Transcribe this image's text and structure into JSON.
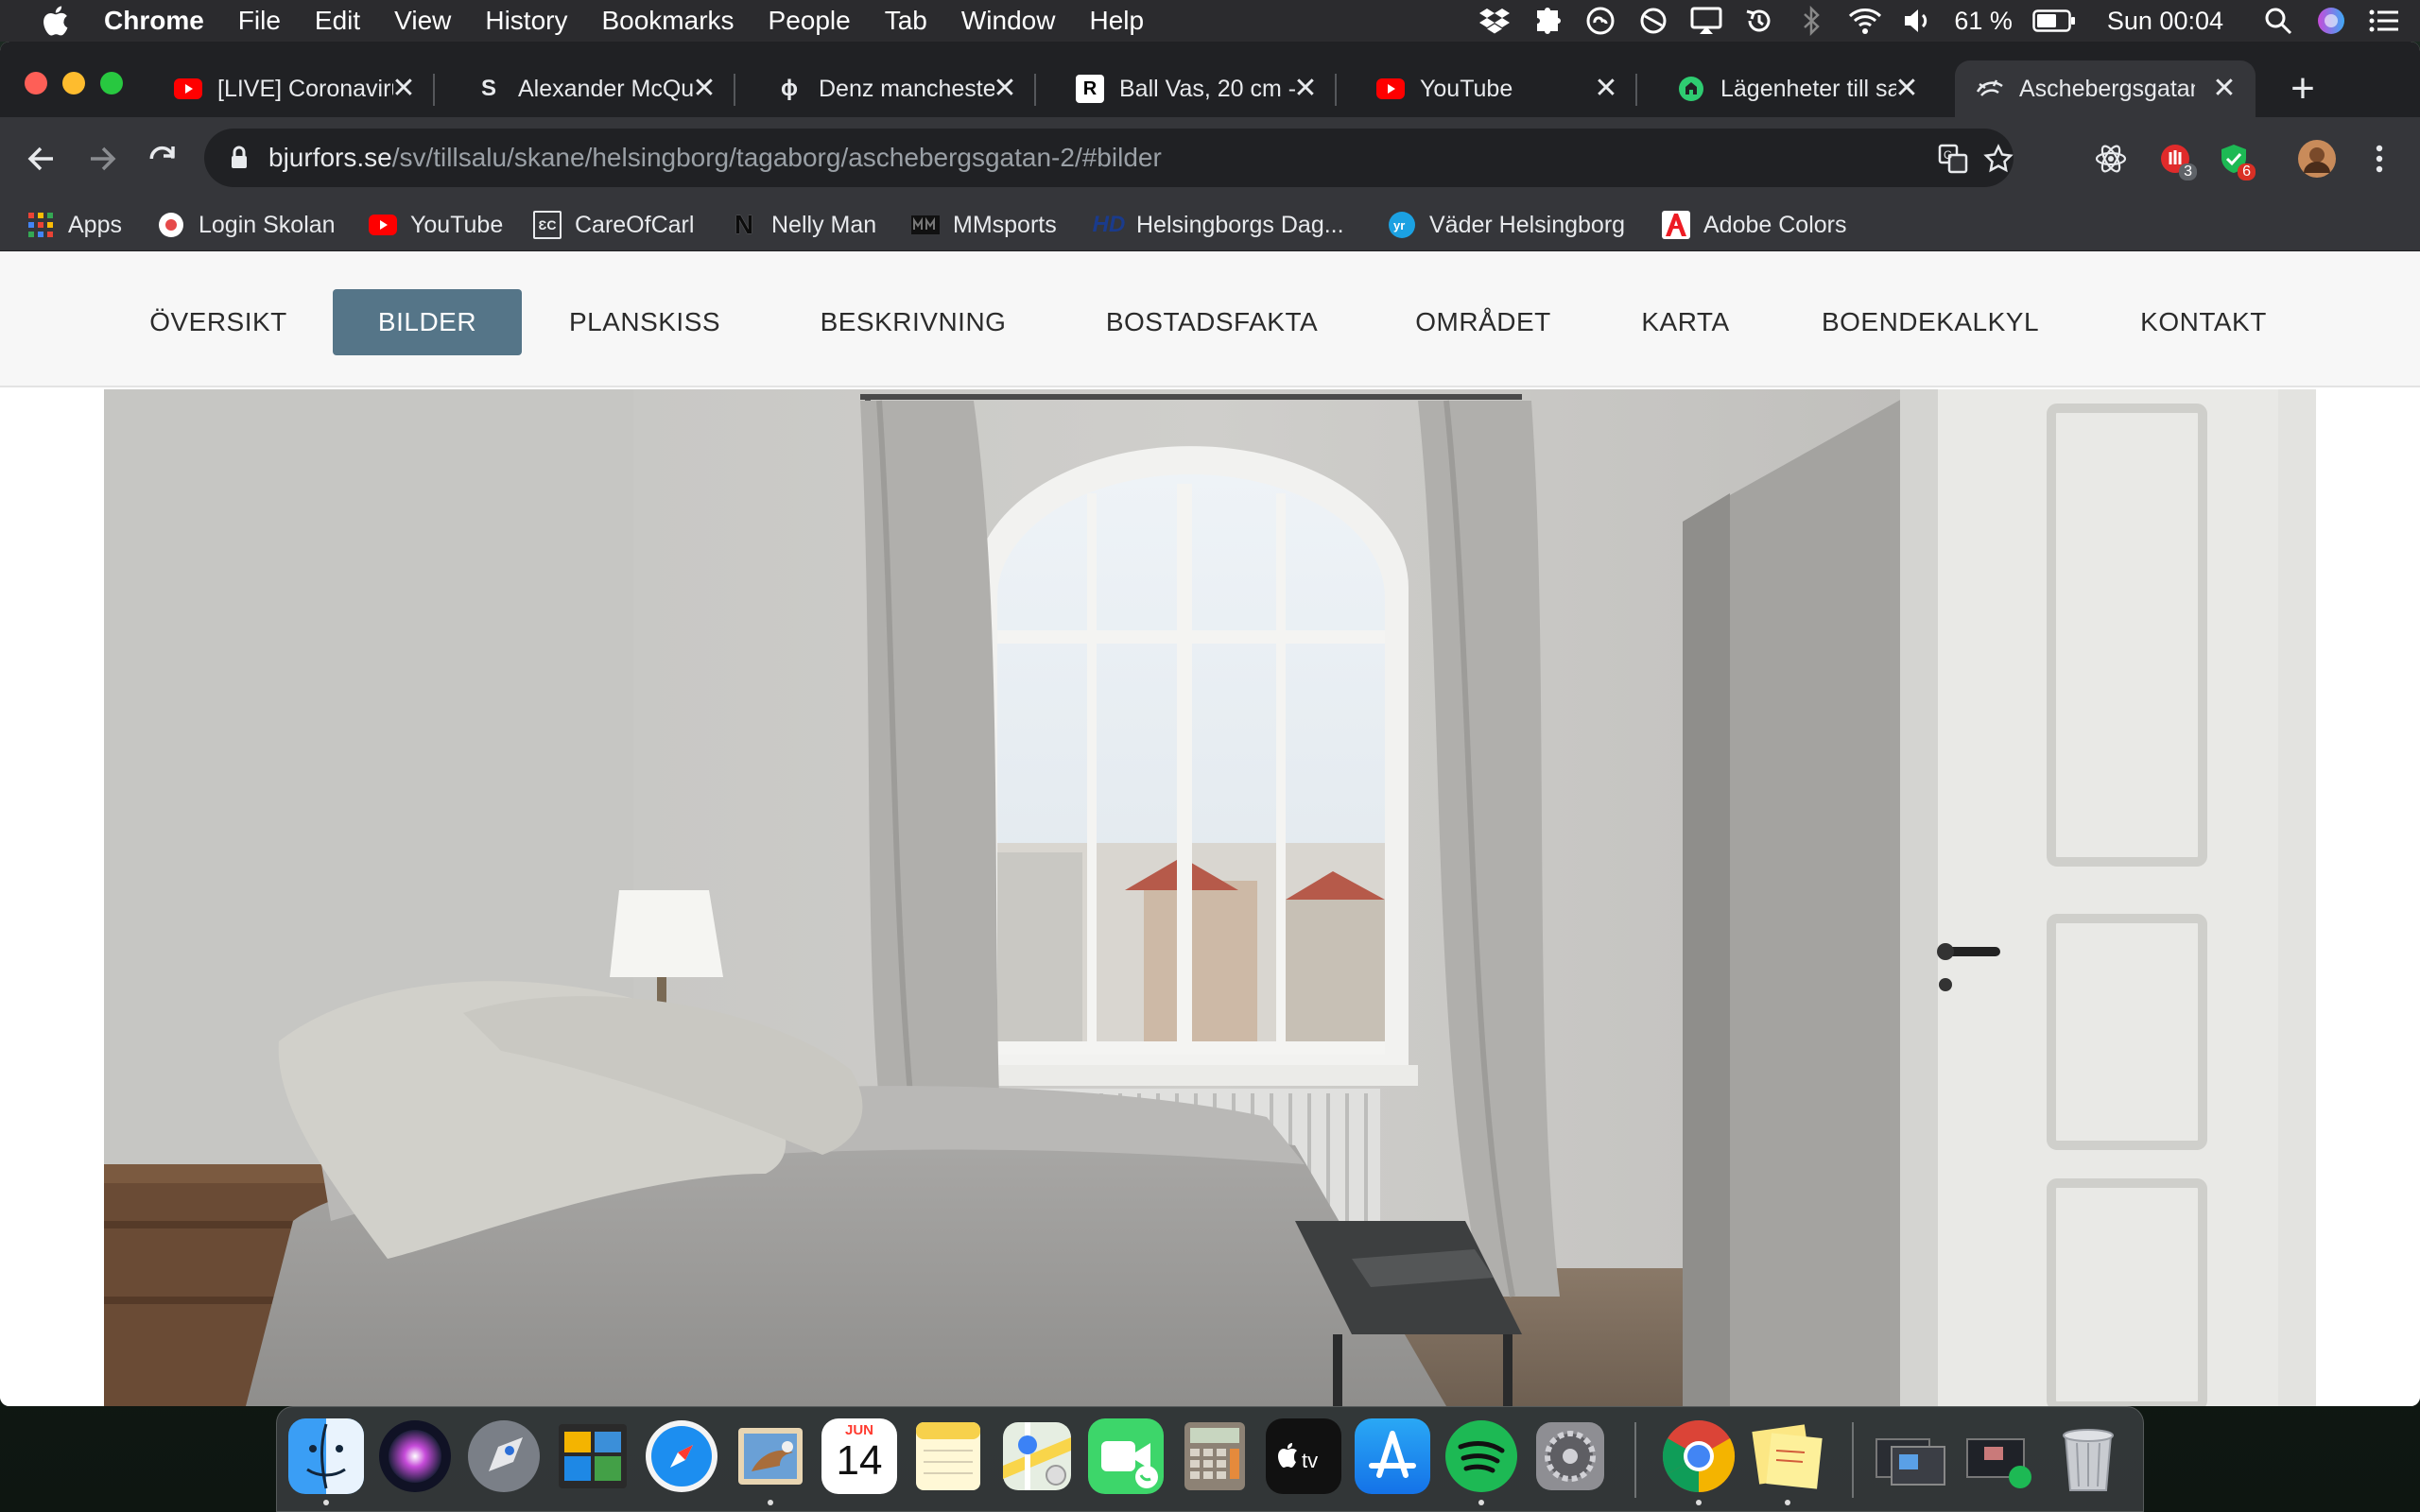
{
  "menubar": {
    "app_name": "Chrome",
    "menus": [
      "File",
      "Edit",
      "View",
      "History",
      "Bookmarks",
      "People",
      "Tab",
      "Window",
      "Help"
    ],
    "battery": "61 %",
    "clock": "Sun 00:04",
    "tray_icons": [
      "dropbox-icon",
      "puzzle-icon",
      "creative-cloud-icon",
      "circle-icon",
      "airplay-icon",
      "time-machine-icon",
      "bluetooth-icon",
      "wifi-icon",
      "volume-icon",
      "battery-icon",
      "search-icon",
      "siri-icon",
      "control-list-icon"
    ]
  },
  "tabs": [
    {
      "title": "[LIVE] Coronavirus",
      "favicon": "youtube-icon",
      "active": false
    },
    {
      "title": "Alexander McQueen",
      "favicon": "S",
      "active": false
    },
    {
      "title": "Denz manchester",
      "favicon": "ϕ",
      "active": false
    },
    {
      "title": "Ball Vas, 20 cm -",
      "favicon": "R",
      "active": false
    },
    {
      "title": "YouTube",
      "favicon": "youtube-icon",
      "active": false
    },
    {
      "title": "Lägenheter till salu",
      "favicon": "hemnet-icon",
      "active": false
    },
    {
      "title": "Aschebergsgatan",
      "favicon": "bjurfors-icon",
      "active": true
    }
  ],
  "address_bar": {
    "host": "bjurfors.se",
    "path": "/sv/tillsalu/skane/helsingborg/tagaborg/aschebergsgatan-2/#bilder"
  },
  "extensions": [
    {
      "icon": "react-icon",
      "badge": ""
    },
    {
      "icon": "shield-red-icon",
      "badge": "3",
      "badge_color": "#5f6368"
    },
    {
      "icon": "shield-green-icon",
      "badge": "6",
      "badge_color": "#d93025"
    }
  ],
  "bookmarks": [
    {
      "label": "Apps",
      "icon": "apps-grid-icon"
    },
    {
      "label": "Login Skolan",
      "icon": "skolan-icon"
    },
    {
      "label": "YouTube",
      "icon": "youtube-icon"
    },
    {
      "label": "CareOfCarl",
      "icon": "careofcarl-icon"
    },
    {
      "label": "Nelly Man",
      "icon": "N"
    },
    {
      "label": "MMsports",
      "icon": "mmsports-icon"
    },
    {
      "label": "Helsingborgs Dag...",
      "icon": "HD"
    },
    {
      "label": "Väder Helsingborg",
      "icon": "yr-icon"
    },
    {
      "label": "Adobe Colors",
      "icon": "adobe-icon"
    }
  ],
  "subnav": [
    {
      "label": "ÖVERSIKT",
      "active": false
    },
    {
      "label": "BILDER",
      "active": true
    },
    {
      "label": "PLANSKISS",
      "active": false
    },
    {
      "label": "BESKRIVNING",
      "active": false
    },
    {
      "label": "BOSTADSFAKTA",
      "active": false
    },
    {
      "label": "OMRÅDET",
      "active": false
    },
    {
      "label": "KARTA",
      "active": false
    },
    {
      "label": "BOENDEKALKYL",
      "active": false
    },
    {
      "label": "KONTAKT",
      "active": false
    }
  ],
  "colors": {
    "subnav_active": "#557588",
    "chrome_dark": "#202124",
    "chrome_toolbar": "#35363a"
  },
  "calendar": {
    "month": "JUN",
    "day": "14"
  },
  "dock": [
    "finder-icon",
    "siri-icon",
    "launchpad-icon",
    "photo-booth-icon",
    "safari-icon",
    "mail-icon",
    "calendar-icon",
    "notes-icon",
    "maps-icon",
    "facetime-icon",
    "calculator-icon",
    "apple-tv-icon",
    "app-store-icon",
    "spotify-icon",
    "system-preferences-icon",
    "chrome-icon",
    "stickies-icon",
    "downloads-stack-icon",
    "screenshots-stack-icon",
    "trash-icon"
  ]
}
